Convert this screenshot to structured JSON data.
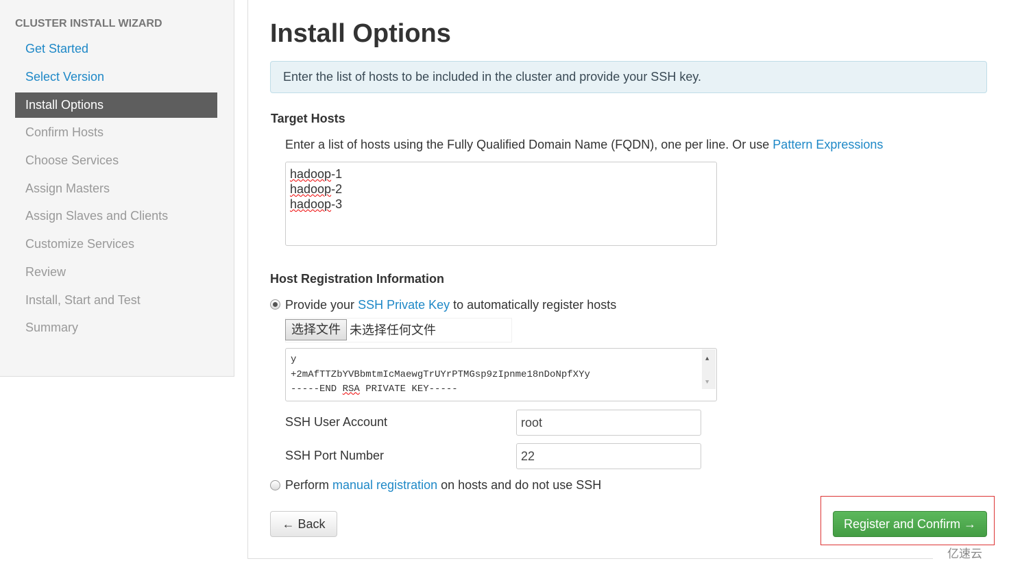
{
  "sidebar": {
    "title": "CLUSTER INSTALL WIZARD",
    "items": [
      {
        "label": "Get Started",
        "state": "done"
      },
      {
        "label": "Select Version",
        "state": "done"
      },
      {
        "label": "Install Options",
        "state": "active"
      },
      {
        "label": "Confirm Hosts",
        "state": "todo"
      },
      {
        "label": "Choose Services",
        "state": "todo"
      },
      {
        "label": "Assign Masters",
        "state": "todo"
      },
      {
        "label": "Assign Slaves and Clients",
        "state": "todo"
      },
      {
        "label": "Customize Services",
        "state": "todo"
      },
      {
        "label": "Review",
        "state": "todo"
      },
      {
        "label": "Install, Start and Test",
        "state": "todo"
      },
      {
        "label": "Summary",
        "state": "todo"
      }
    ]
  },
  "main": {
    "title": "Install Options",
    "alert": "Enter the list of hosts to be included in the cluster and provide your SSH key.",
    "target": {
      "heading": "Target Hosts",
      "desc": "Enter a list of hosts using the Fully Qualified Domain Name (FQDN), one per line. Or use ",
      "link": "Pattern Expressions",
      "hosts": [
        "hadoop",
        "-1",
        "hadoop",
        "-2",
        "hadoop",
        "-3"
      ]
    },
    "reg": {
      "heading": "Host Registration Information",
      "opt1_pre": "Provide your ",
      "opt1_link": "SSH Private Key",
      "opt1_post": " to automatically register hosts",
      "file_button": "选择文件",
      "file_status": "未选择任何文件",
      "key_lines": [
        "y",
        "+2mAfTTZbYVBbmtmIcMaewgTrUYrPTMGsp9zIpnme18nDoNpfXYy",
        "-----END ",
        "RSA",
        " PRIVATE KEY-----"
      ],
      "user_label": "SSH User Account",
      "user_value": "root",
      "port_label": "SSH Port Number",
      "port_value": "22",
      "opt2_pre": "Perform ",
      "opt2_link": "manual registration",
      "opt2_post": " on hosts and do not use SSH"
    },
    "back": "← Back",
    "register": "Register and Confirm →"
  },
  "watermark": "亿速云",
  "colors": {
    "link": "#1e88c7",
    "active": "#5e5e5e",
    "success": "#5cb85c"
  }
}
